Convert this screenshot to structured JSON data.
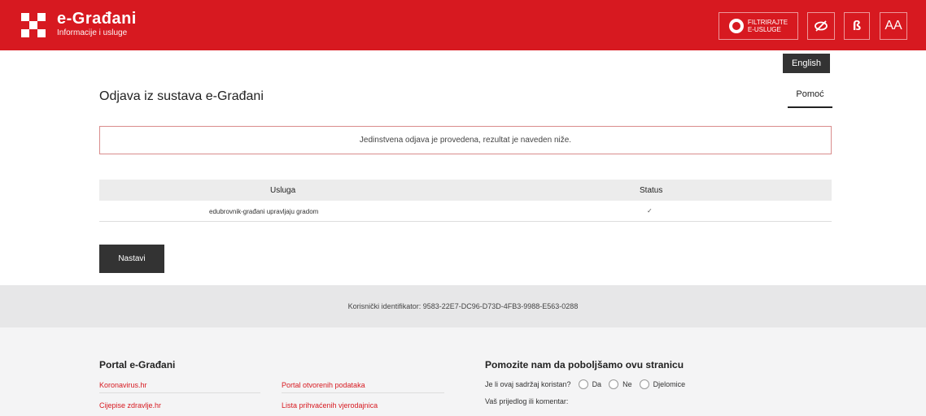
{
  "header": {
    "title": "e-Građani",
    "subtitle": "Informacije i usluge",
    "filter_line1": "FILTRIRAJTE",
    "filter_line2": "E-USLUGE",
    "dyslexia_label": "ß",
    "font_size_label": "AA"
  },
  "language_button": "English",
  "page": {
    "title": "Odjava iz sustava e-Građani",
    "help_link": "Pomoć",
    "notice": "Jedinstvena odjava je provedena, rezultat je naveden niže.",
    "table": {
      "columns": [
        "Usluga",
        "Status"
      ],
      "rows": [
        {
          "service": "edubrovnik-građani upravljaju gradom",
          "status": "✓"
        }
      ]
    },
    "continue_button": "Nastavi"
  },
  "user_id_text": "Korisnički identifikator: 9583-22E7-DC96-D73D-4FB3-9988-E563-0288",
  "footer": {
    "portal_title": "Portal e-Građani",
    "links": [
      "Koronavirus.hr",
      "Portal otvorenih podataka",
      "Cijepise zdravlje.hr",
      "Lista prihvaćenih vjerodajnica"
    ],
    "feedback_title": "Pomozite nam da poboljšamo ovu stranicu",
    "question": "Je li ovaj sadržaj koristan?",
    "options": [
      "Da",
      "Ne",
      "Djelomice"
    ],
    "comment_label": "Vaš prijedlog ili komentar:"
  },
  "colors": {
    "brand_red": "#d71920",
    "dark_button": "#333333"
  },
  "icons": [
    "globe-icon",
    "eye-slash-icon"
  ]
}
